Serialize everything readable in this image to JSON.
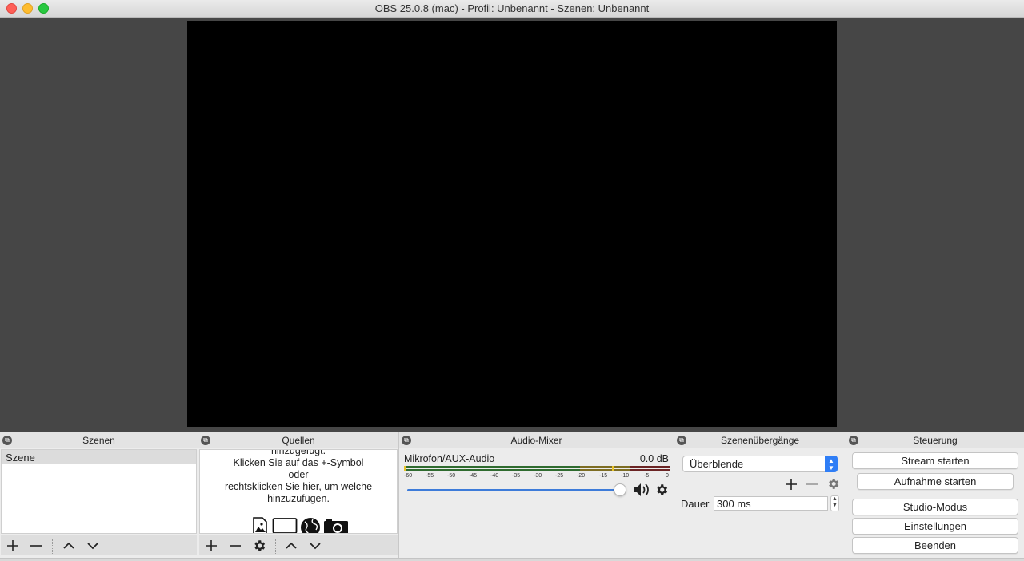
{
  "window": {
    "title": "OBS 25.0.8 (mac) - Profil: Unbenannt - Szenen: Unbenannt"
  },
  "colors": {
    "preview_bg": "#464646",
    "canvas": "#000000",
    "accent": "#2f7ef6"
  },
  "docks": {
    "scenes": {
      "title": "Szenen",
      "items": [
        "Szene"
      ],
      "selected_index": 0,
      "toolbar_icons": [
        "plus-icon",
        "minus-icon",
        "chevron-up-icon",
        "chevron-down-icon"
      ]
    },
    "sources": {
      "title": "Quellen",
      "hint_lines": [
        "hinzugefügt.",
        "Klicken Sie auf das +-Symbol",
        "oder",
        "rechtsklicken Sie hier, um welche",
        "hinzuzufügen."
      ],
      "hint_icons": [
        "image-source-icon",
        "display-capture-icon",
        "browser-source-icon",
        "camera-source-icon"
      ],
      "toolbar_icons": [
        "plus-icon",
        "minus-icon",
        "gear-icon",
        "chevron-up-icon",
        "chevron-down-icon"
      ]
    },
    "audio_mixer": {
      "title": "Audio-Mixer",
      "channel": {
        "name": "Mikrofon/AUX-Audio",
        "level": "0.0 dB",
        "scale": [
          "-60",
          "-55",
          "-50",
          "-45",
          "-40",
          "-35",
          "-30",
          "-25",
          "-20",
          "-15",
          "-10",
          "-5",
          "0"
        ],
        "volume_fraction": 1.0
      }
    },
    "transitions": {
      "title": "Szenenübergänge",
      "selected": "Überblende",
      "duration_label": "Dauer",
      "duration_value": "300 ms"
    },
    "controls": {
      "title": "Steuerung",
      "buttons": [
        "Stream starten",
        "Aufnahme starten",
        "Studio-Modus",
        "Einstellungen",
        "Beenden"
      ]
    }
  }
}
